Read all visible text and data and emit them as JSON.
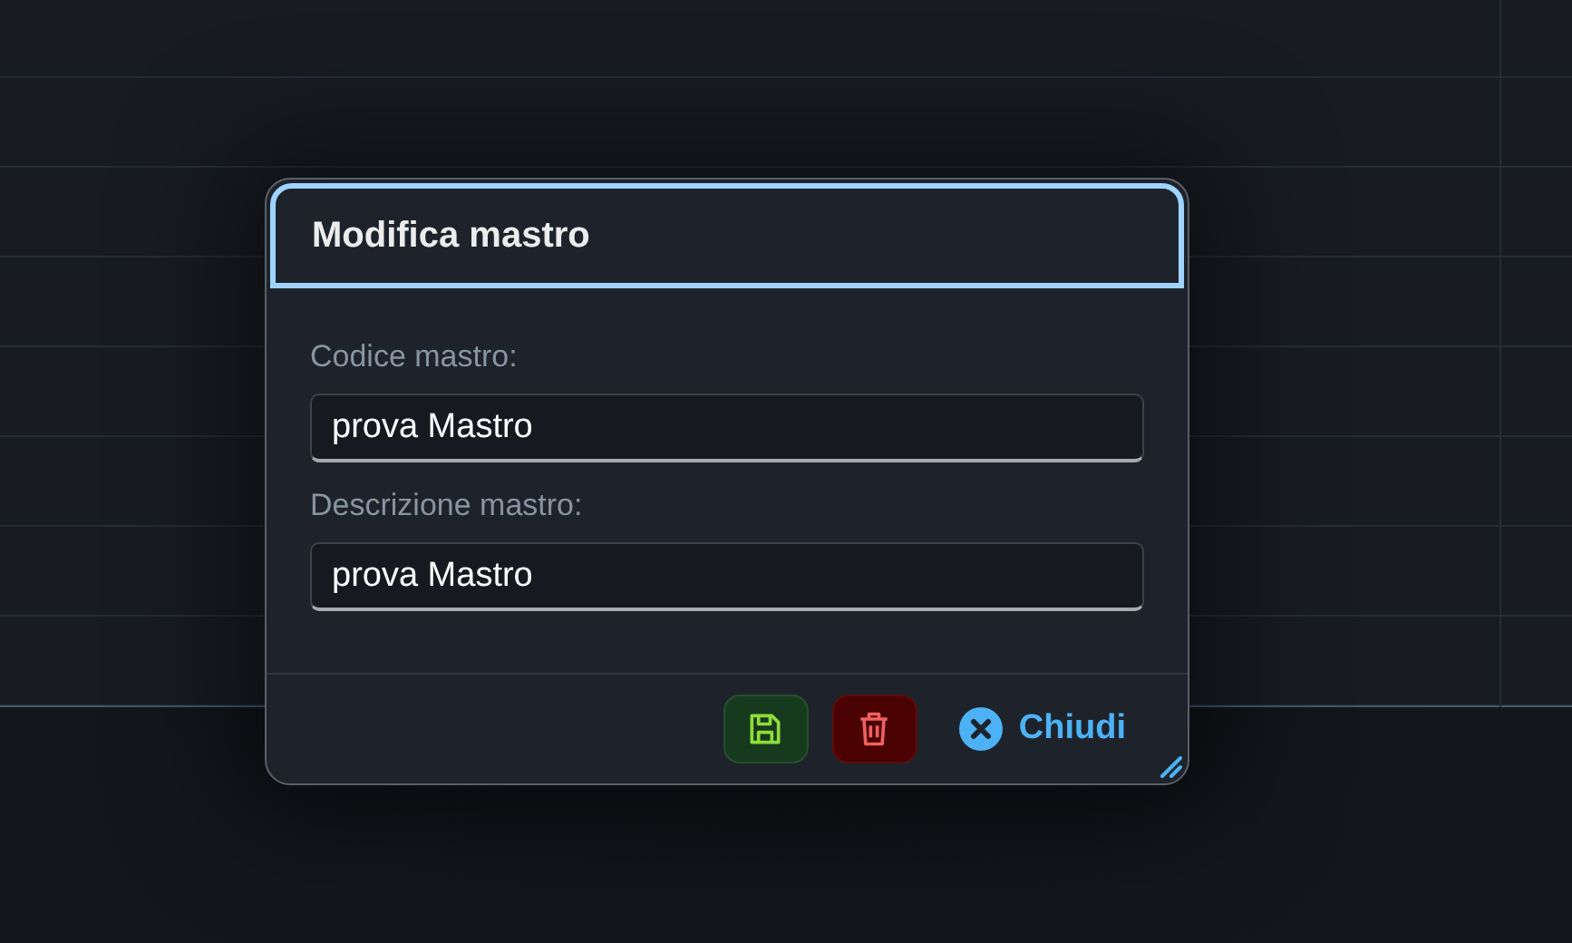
{
  "dialog": {
    "title": "Modifica mastro",
    "fields": [
      {
        "label": "Codice mastro:",
        "value": "prova Mastro"
      },
      {
        "label": "Descrizione mastro:",
        "value": "prova Mastro"
      }
    ],
    "buttons": [
      {
        "kind": "save"
      },
      {
        "kind": "delete"
      },
      {
        "kind": "close",
        "label": "Chiudi"
      }
    ]
  }
}
